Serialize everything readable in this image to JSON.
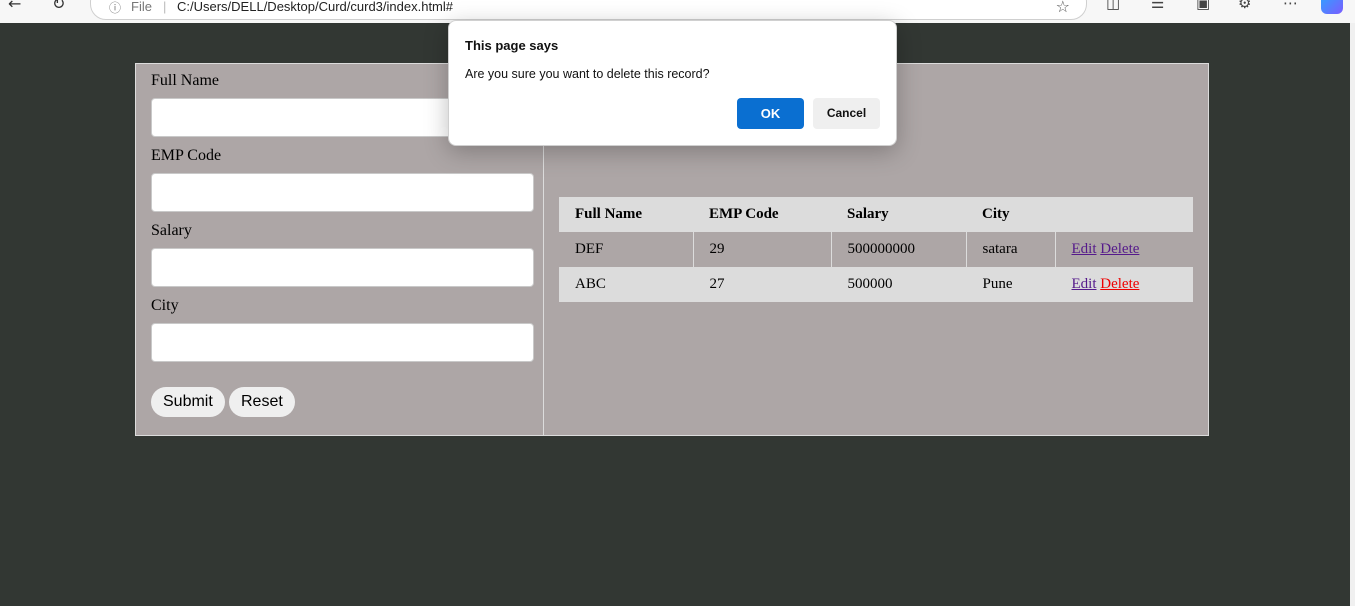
{
  "browser": {
    "address_prefix": "File",
    "url": "C:/Users/DELL/Desktop/Curd/curd3/index.html#"
  },
  "form": {
    "full_name_label": "Full Name",
    "emp_code_label": "EMP Code",
    "salary_label": "Salary",
    "city_label": "City",
    "full_name_value": "",
    "emp_code_value": "",
    "salary_value": "",
    "city_value": "",
    "submit_label": "Submit",
    "reset_label": "Reset"
  },
  "table": {
    "headers": [
      "Full Name",
      "EMP Code",
      "Salary",
      "City",
      ""
    ],
    "rows": [
      {
        "full_name": "DEF",
        "emp_code": "29",
        "salary": "500000000",
        "city": "satara",
        "edit": "Edit",
        "delete": "Delete"
      },
      {
        "full_name": "ABC",
        "emp_code": "27",
        "salary": "500000",
        "city": "Pune",
        "edit": "Edit",
        "delete": "Delete"
      }
    ]
  },
  "dialog": {
    "title": "This page says",
    "message": "Are you sure you want to delete this record?",
    "ok_label": "OK",
    "cancel_label": "Cancel"
  },
  "colors": {
    "page_bg": "#323733",
    "panel_bg": "#ada6a6",
    "ok_button": "#0a6fd1",
    "active_delete_link": "#ee0000"
  }
}
